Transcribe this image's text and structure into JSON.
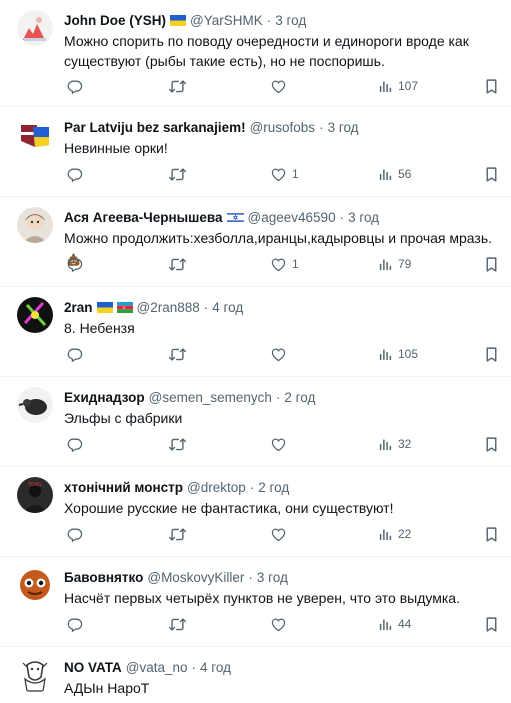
{
  "tweets": [
    {
      "name": "John Doe (YSH)",
      "handle": "@YarSHMK",
      "dot": "·",
      "time": "3 год",
      "text_lines": [
        "Можно спорить по поводу очередности и единороги вроде как",
        "существуют (рыбы такие есть), но не поспоришь."
      ],
      "likes": "",
      "views": "107",
      "flags": [
        "ukraine"
      ]
    },
    {
      "name": "Par Latviju bez sarkanajiem!",
      "handle": "@rusofobs",
      "dot": "·",
      "time": "3 год",
      "text_lines": [
        "Невинные орки!"
      ],
      "likes": "1",
      "views": "56",
      "flags": []
    },
    {
      "name": "Ася Агеева-Чернышева",
      "handle": "@ageev46590",
      "dot": "·",
      "time": "3 год",
      "text_lines": [
        "Можно продолжить:хезболла,иранцы,кадыровцы и прочая мразь."
      ],
      "emoji": "poop",
      "likes": "1",
      "views": "79",
      "flags": [
        "israel"
      ]
    },
    {
      "name": "2ran",
      "handle": "@2ran888",
      "dot": "·",
      "time": "4 год",
      "text_lines": [
        "8. Небензя"
      ],
      "likes": "",
      "views": "105",
      "flags": [
        "ukraine",
        "azerbaijan"
      ]
    },
    {
      "name": "Ехиднадзор",
      "handle": "@semen_semenych",
      "dot": "·",
      "time": "2 год",
      "text_lines": [
        "Эльфы с фабрики"
      ],
      "likes": "",
      "views": "32",
      "flags": []
    },
    {
      "name": "хтонічний монстр",
      "handle": "@drektop",
      "dot": "·",
      "time": "2 год",
      "text_lines": [
        "Хорошие русские не фантастика, они существуют!"
      ],
      "likes": "",
      "views": "22",
      "flags": []
    },
    {
      "name": "Бавовнятко",
      "handle": "@MoskovyKiller",
      "dot": "·",
      "time": "3 год",
      "text_lines": [
        "Насчёт первых четырёх пунктов не уверен, что это выдумка."
      ],
      "likes": "",
      "views": "44",
      "flags": []
    },
    {
      "name": "NO VATA",
      "handle": "@vata_no",
      "dot": "·",
      "time": "4 год",
      "text_lines": [
        "АДЫн НароТ"
      ],
      "likes": "",
      "views": "",
      "flags": []
    }
  ],
  "colors": {
    "text": "#0f1419",
    "secondary": "#536471",
    "divider": "#eff3f4"
  },
  "icons": [
    "reply-icon",
    "retweet-icon",
    "like-icon",
    "views-icon",
    "bookmark-icon"
  ]
}
